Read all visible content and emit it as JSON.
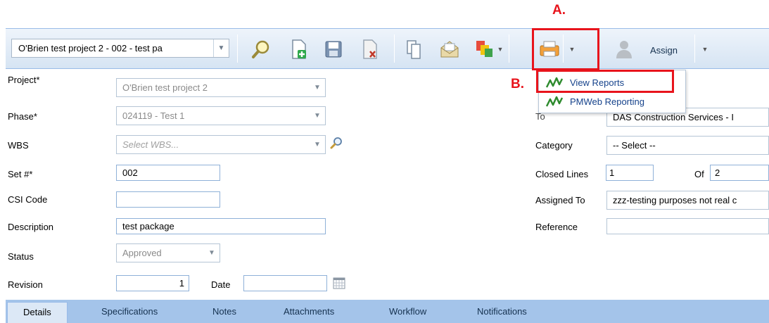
{
  "annotations": {
    "a": "A.",
    "b": "B."
  },
  "toolbar": {
    "project_select": "O'Brien test project 2 - 002 - test pa",
    "assign_label": "Assign",
    "icons": [
      "search-icon",
      "new-document-icon",
      "save-icon",
      "delete-icon",
      "copy-icon",
      "email-icon",
      "transfer-icon",
      "print-icon",
      "user-icon"
    ]
  },
  "print_menu": {
    "items": [
      {
        "label": "View Reports"
      },
      {
        "label": "PMWeb Reporting"
      }
    ]
  },
  "form": {
    "project": {
      "label": "Project*",
      "value": "O'Brien test project 2"
    },
    "phase": {
      "label": "Phase*",
      "value": "024119 - Test 1"
    },
    "wbs": {
      "label": "WBS",
      "placeholder": "Select WBS..."
    },
    "set_no": {
      "label": "Set #*",
      "value": "002"
    },
    "csi_code": {
      "label": "CSI Code",
      "value": ""
    },
    "description": {
      "label": "Description",
      "value": "test package"
    },
    "status": {
      "label": "Status",
      "value": "Approved"
    },
    "revision": {
      "label": "Revision",
      "value": "1"
    },
    "date": {
      "label": "Date",
      "value": ""
    },
    "to": {
      "label": "To",
      "value": "DAS Construction Services - I"
    },
    "category": {
      "label": "Category",
      "value": "-- Select --"
    },
    "closed_lines": {
      "label": "Closed Lines",
      "value": "1"
    },
    "of": {
      "label": "Of",
      "value": "2"
    },
    "assigned_to": {
      "label": "Assigned To",
      "value": "zzz-testing purposes not real c"
    },
    "reference": {
      "label": "Reference",
      "value": ""
    }
  },
  "tabs": [
    {
      "label": "Details",
      "active": true
    },
    {
      "label": "Specifications"
    },
    {
      "label": "Notes"
    },
    {
      "label": "Attachments"
    },
    {
      "label": "Workflow"
    },
    {
      "label": "Notifications"
    }
  ],
  "colors": {
    "annotation_red": "#e8141c",
    "menu_text": "#15428b",
    "tab_bar": "#a4c4ea"
  }
}
